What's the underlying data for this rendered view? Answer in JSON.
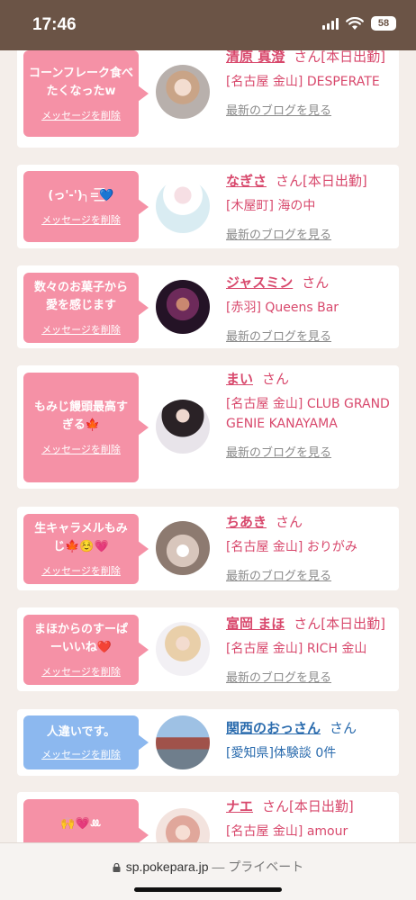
{
  "status_bar": {
    "time": "17:46",
    "battery": "58"
  },
  "browser": {
    "domain": "sp.pokepara.jp",
    "separator": " — ",
    "mode": "プライベート"
  },
  "delete_label": "メッセージを削除",
  "blog_label": "最新のブログを見る",
  "san": "さん",
  "cards": [
    {
      "message": "コーンフレーク食べたくなったw",
      "name": "清原 真澄",
      "status": "[本日出勤]",
      "shop": "[名古屋 金山] DESPERATE",
      "blog": true,
      "bubble": "pink"
    },
    {
      "message": "(っ'-')╮=͟͟͞͞💙",
      "name": "なぎさ",
      "status": "[本日出勤]",
      "shop": "[木屋町] 海の中",
      "blog": true,
      "bubble": "pink"
    },
    {
      "message": "数々のお菓子から愛を感じます",
      "name": "ジャスミン",
      "status": "",
      "shop": "[赤羽] Queens Bar",
      "blog": true,
      "bubble": "pink"
    },
    {
      "message": "もみじ饅頭最高すぎる🍁",
      "name": "まい",
      "status": "",
      "shop": "[名古屋 金山] CLUB GRAND GENIE KANAYAMA",
      "blog": true,
      "bubble": "pink"
    },
    {
      "message": "生キャラメルもみじ🍁☺️💗",
      "name": "ちあき",
      "status": "",
      "shop": "[名古屋 金山] おりがみ",
      "blog": true,
      "bubble": "pink"
    },
    {
      "message": "まほからのすーぱーいいね❤️",
      "name": "富岡 まほ",
      "status": "[本日出勤]",
      "shop": "[名古屋 金山] RICH 金山",
      "blog": true,
      "bubble": "pink"
    },
    {
      "message": "人違いです。",
      "name": "関西のおっさん",
      "status": "",
      "shop": "[愛知県]体験談 0件",
      "blog": false,
      "bubble": "blue"
    },
    {
      "message": "🙌💗ꔛ",
      "name": "ナエ",
      "status": "[本日出勤]",
      "shop": "[名古屋 金山] amour",
      "blog": false,
      "bubble": "pink"
    }
  ]
}
